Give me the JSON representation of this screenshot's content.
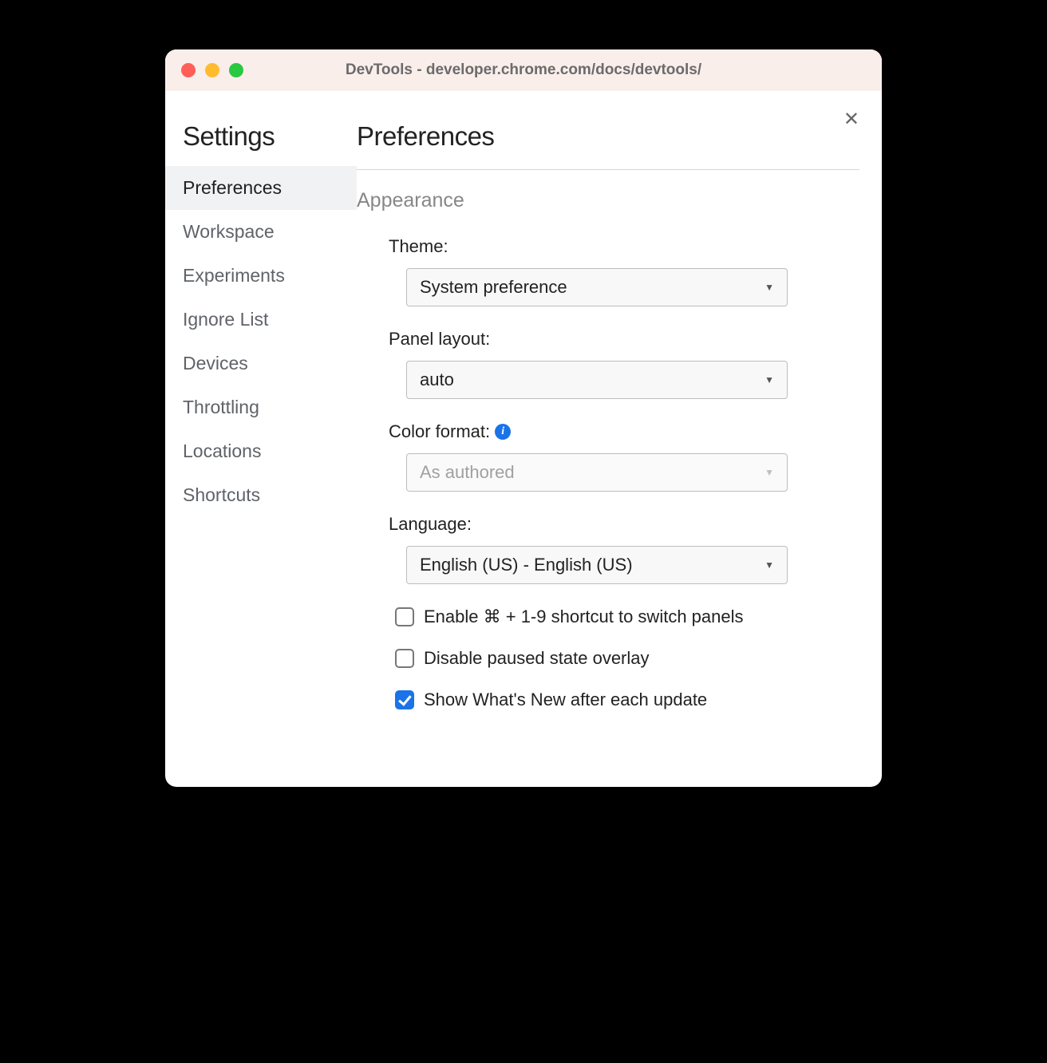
{
  "window": {
    "title": "DevTools - developer.chrome.com/docs/devtools/"
  },
  "sidebar": {
    "title": "Settings",
    "items": [
      {
        "label": "Preferences",
        "active": true
      },
      {
        "label": "Workspace",
        "active": false
      },
      {
        "label": "Experiments",
        "active": false
      },
      {
        "label": "Ignore List",
        "active": false
      },
      {
        "label": "Devices",
        "active": false
      },
      {
        "label": "Throttling",
        "active": false
      },
      {
        "label": "Locations",
        "active": false
      },
      {
        "label": "Shortcuts",
        "active": false
      }
    ]
  },
  "main": {
    "title": "Preferences",
    "section": "Appearance",
    "fields": {
      "theme": {
        "label": "Theme:",
        "value": "System preference"
      },
      "panel_layout": {
        "label": "Panel layout:",
        "value": "auto"
      },
      "color_format": {
        "label": "Color format:",
        "value": "As authored",
        "disabled": true,
        "info": true
      },
      "language": {
        "label": "Language:",
        "value": "English (US) - English (US)"
      }
    },
    "checkboxes": [
      {
        "label": "Enable ⌘ + 1-9 shortcut to switch panels",
        "checked": false
      },
      {
        "label": "Disable paused state overlay",
        "checked": false
      },
      {
        "label": "Show What's New after each update",
        "checked": true
      }
    ]
  }
}
